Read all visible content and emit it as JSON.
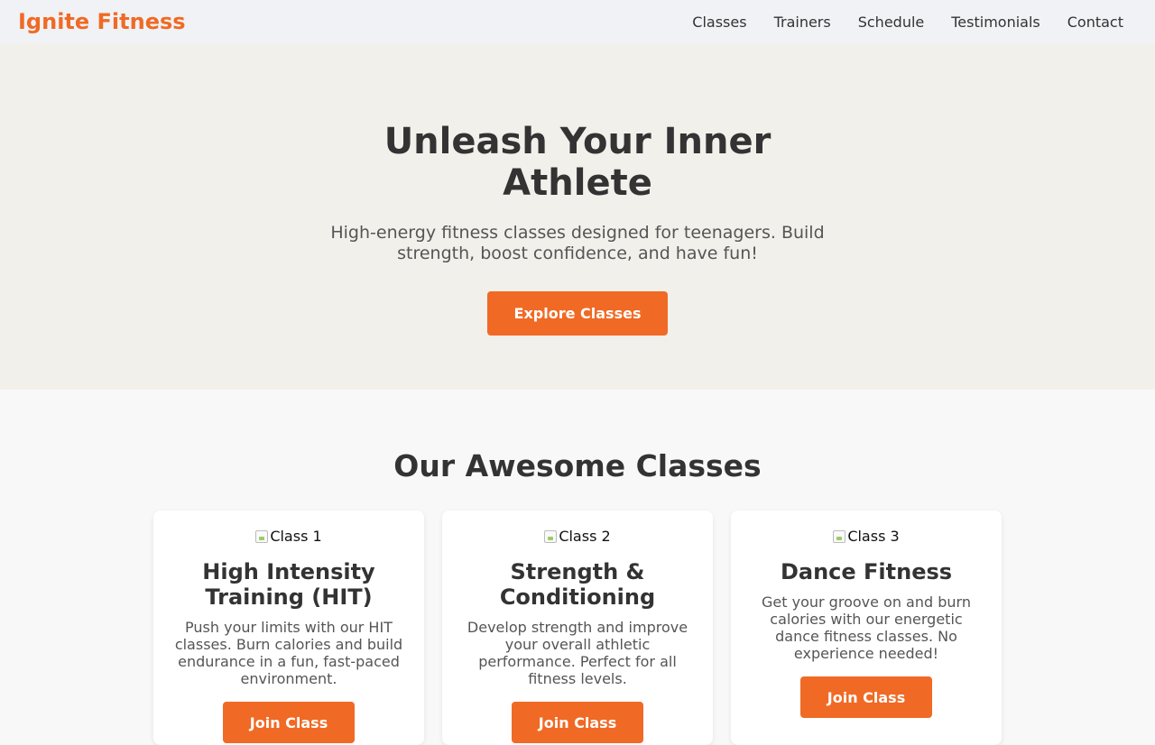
{
  "nav": {
    "brand": "Ignite Fitness",
    "links": [
      "Classes",
      "Trainers",
      "Schedule",
      "Testimonials",
      "Contact"
    ]
  },
  "hero": {
    "title_line1": "Unleash Your Inner",
    "title_line2": "Athlete",
    "subtitle": "High-energy fitness classes designed for teenagers. Build strength, boost confidence, and have fun!",
    "cta_label": "Explore Classes"
  },
  "classes": {
    "title": "Our Awesome Classes",
    "cards": [
      {
        "image_alt": "Class 1",
        "title": "High Intensity Training (HIT)",
        "description": "Push your limits with our HIT classes. Burn calories and build endurance in a fun, fast-paced environment.",
        "button_label": "Join Class"
      },
      {
        "image_alt": "Class 2",
        "title": "Strength & Conditioning",
        "description": "Develop strength and improve your overall athletic performance. Perfect for all fitness levels.",
        "button_label": "Join Class"
      },
      {
        "image_alt": "Class 3",
        "title": "Dance Fitness",
        "description": "Get your groove on and burn calories with our energetic dance fitness classes. No experience needed!",
        "button_label": "Join Class"
      }
    ]
  },
  "colors": {
    "accent": "#f06a25",
    "nav_bg": "#f0f2f5",
    "hero_bg": "#f2f0eb",
    "section_bg": "#f8f8f8",
    "text": "#333333"
  },
  "icons": {
    "card_image": "broken-image-icon"
  }
}
